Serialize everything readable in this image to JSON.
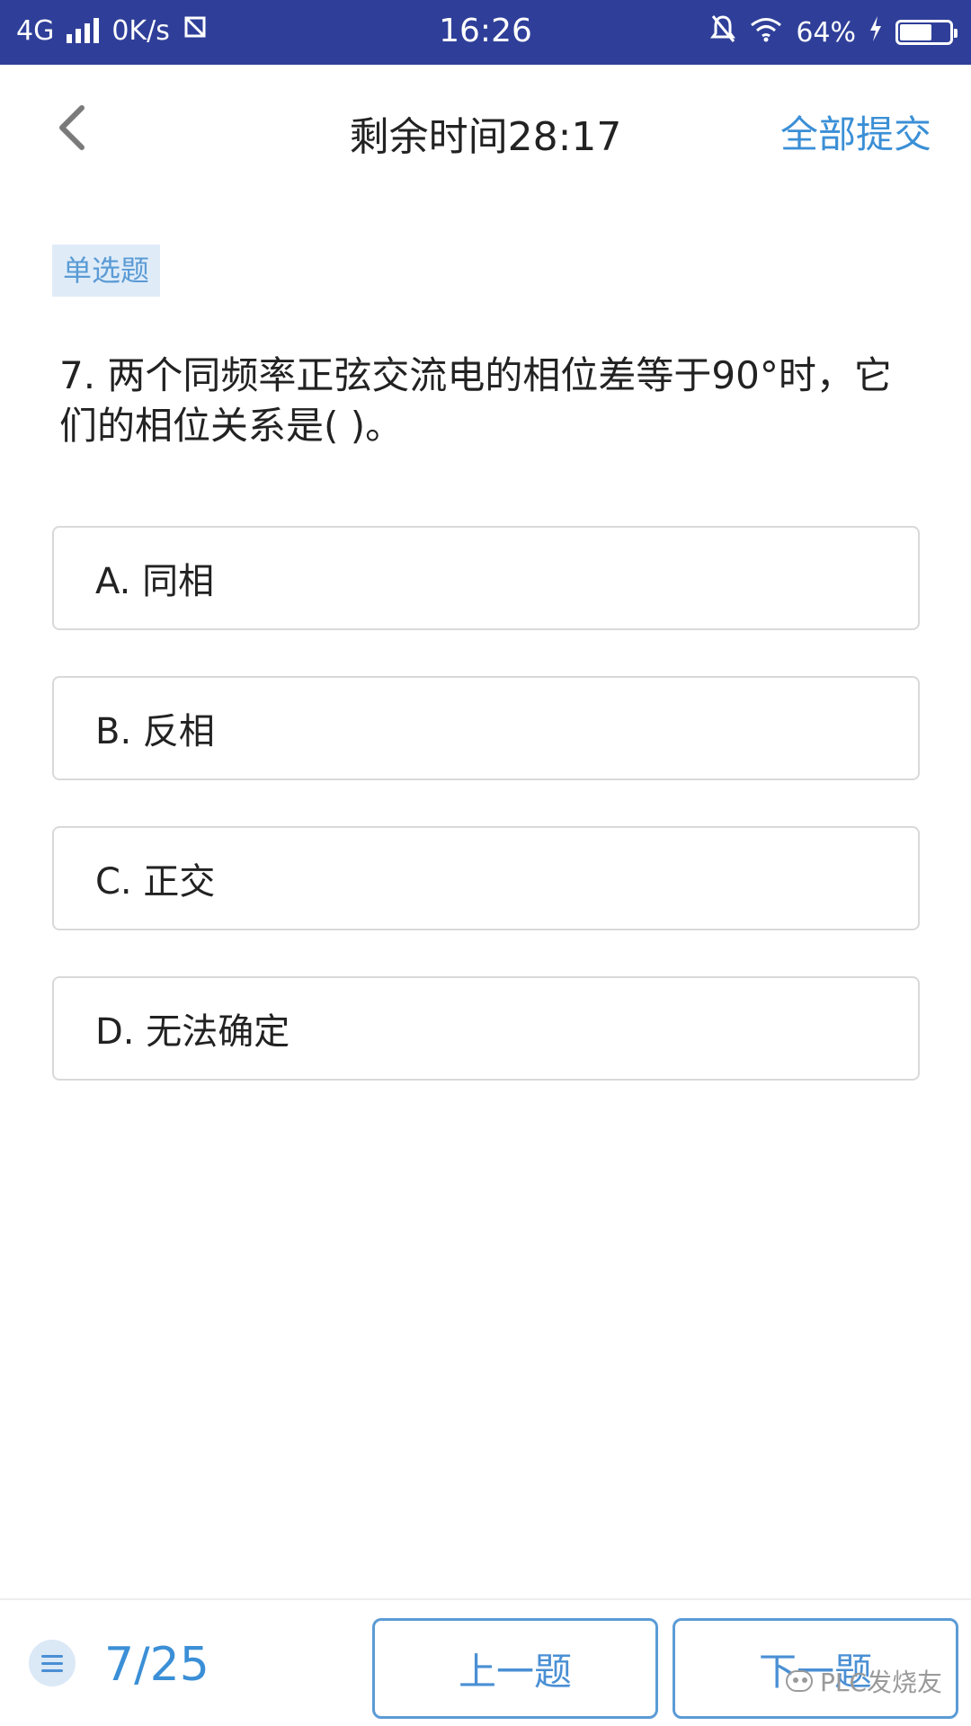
{
  "status_bar": {
    "network": "4G",
    "speed": "0K/s",
    "time": "16:26",
    "battery": "64%",
    "battery_level": 0.64
  },
  "header": {
    "title": "剩余时间28:17",
    "submit_all": "全部提交"
  },
  "question": {
    "type_label": "单选题",
    "text": "7. 两个同频率正弦交流电的相位差等于90°时，它们的相位关系是( )。",
    "options": [
      {
        "label": "A. 同相"
      },
      {
        "label": "B. 反相"
      },
      {
        "label": "C. 正交"
      },
      {
        "label": "D. 无法确定"
      }
    ]
  },
  "footer": {
    "progress": "7/25",
    "prev_label": "上一题",
    "next_label": "下一题",
    "watermark": "PLC发烧友"
  },
  "colors": {
    "status_bar": "#2f3f99",
    "accent": "#3b8fd6",
    "tag_bg": "#dfecf8"
  }
}
